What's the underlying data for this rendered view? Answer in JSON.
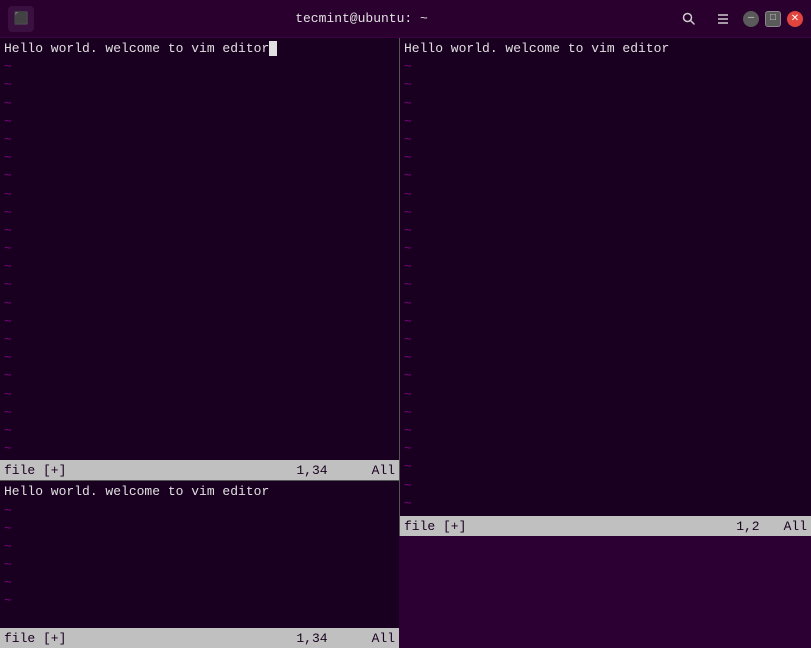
{
  "titlebar": {
    "title": "tecmint@ubuntu: ~",
    "search_label": "🔍",
    "menu_label": "≡",
    "min_label": "—",
    "max_label": "□",
    "close_label": "✕"
  },
  "left_top": {
    "line1": "Hello world. welcome to vim editor",
    "tildes": [
      "~",
      "~",
      "~",
      "~",
      "~",
      "~",
      "~",
      "~",
      "~",
      "~",
      "~",
      "~",
      "~",
      "~",
      "~",
      "~",
      "~",
      "~",
      "~",
      "~",
      "~",
      "~"
    ],
    "status_left": "file [+]",
    "status_pos": "1,34",
    "status_right": "All"
  },
  "left_bottom": {
    "line1": "Hello world. welcome to vim editor",
    "tildes": [
      "~",
      "~",
      "~",
      "~",
      "~",
      "~"
    ],
    "status_left": "file [+]",
    "status_pos": "1,34",
    "status_right": "All"
  },
  "right_pane": {
    "line1": "Hello world. welcome to vim editor",
    "tildes": [
      "~",
      "~",
      "~",
      "~",
      "~",
      "~",
      "~",
      "~",
      "~",
      "~",
      "~",
      "~",
      "~",
      "~",
      "~",
      "~",
      "~",
      "~",
      "~",
      "~",
      "~",
      "~",
      "~",
      "~",
      "~",
      "~",
      "~",
      "~",
      "~",
      "~",
      "~"
    ],
    "status_left": "file [+]",
    "status_pos": "1,2",
    "status_right": "All"
  }
}
